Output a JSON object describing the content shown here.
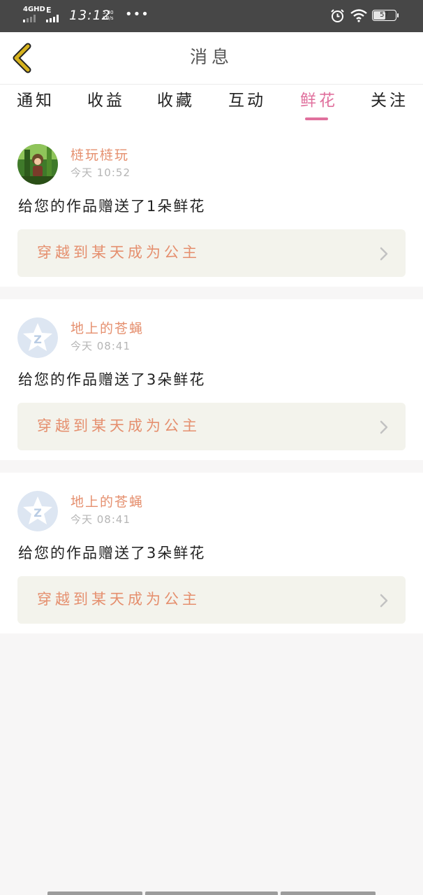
{
  "status_bar": {
    "network": "4GHD",
    "network_secondary": "E",
    "time": "13:12",
    "speed_value": "5.80",
    "speed_unit": "KB/s",
    "more": "•••",
    "battery": "57",
    "icons": [
      "signal-icon",
      "alarm-icon",
      "wifi-icon",
      "battery-icon"
    ]
  },
  "header": {
    "title": "消息",
    "back_icon": "chevron-left-icon"
  },
  "tabs": [
    {
      "label": "通知",
      "active": false
    },
    {
      "label": "收益",
      "active": false
    },
    {
      "label": "收藏",
      "active": false
    },
    {
      "label": "互动",
      "active": false
    },
    {
      "label": "鲜花",
      "active": true
    },
    {
      "label": "关注",
      "active": false
    }
  ],
  "messages": [
    {
      "username": "梿玩梿玩",
      "time": "今天 10:52",
      "text": "给您的作品赠送了1朵鲜花",
      "work_title": "穿越到某天成为公主",
      "avatar": "user-avatar-icon"
    },
    {
      "username": "地上的苍蝇",
      "time": "今天 08:41",
      "text": "给您的作品赠送了3朵鲜花",
      "work_title": "穿越到某天成为公主",
      "avatar": "default-avatar-icon"
    },
    {
      "username": "地上的苍蝇",
      "time": "今天 08:41",
      "text": "给您的作品赠送了3朵鲜花",
      "work_title": "穿越到某天成为公主",
      "avatar": "default-avatar-icon"
    }
  ],
  "colors": {
    "accent": "#e0709d",
    "name": "#e58f6e",
    "back_arrow": "#d6b21e",
    "statusbar": "#474747",
    "link_bg": "#f3f3ec"
  }
}
